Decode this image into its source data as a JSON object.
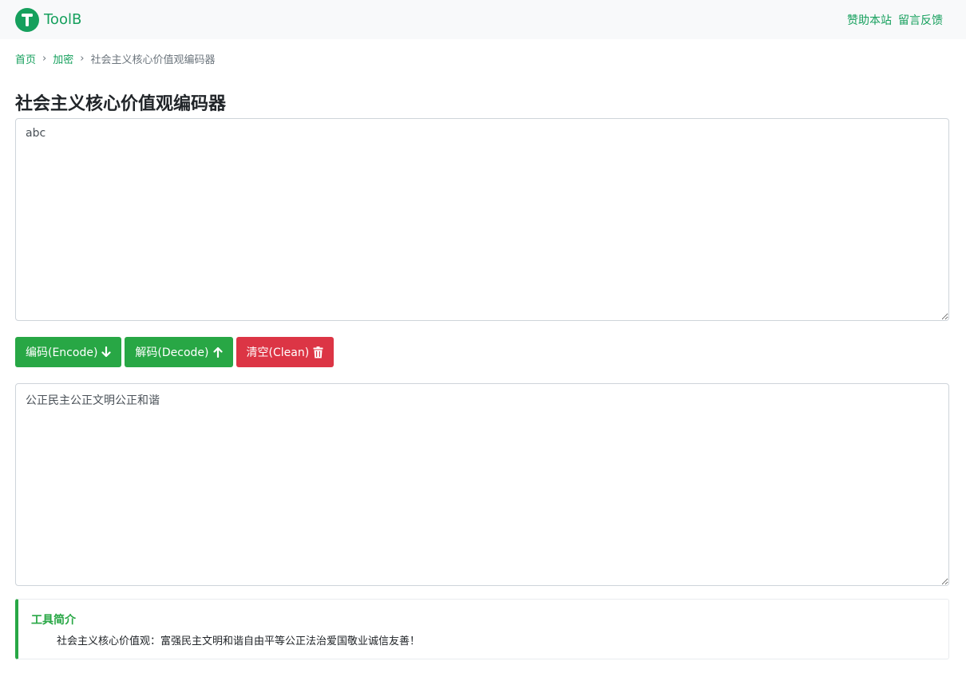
{
  "navbar": {
    "brand": "ToolB",
    "brand_icon": "tool-t-icon",
    "accent": "#16a05d",
    "links": [
      "赞助本站",
      "留言反馈"
    ]
  },
  "breadcrumb": {
    "home": "首页",
    "category": "加密",
    "current": "社会主义核心价值观编码器"
  },
  "page": {
    "title": "社会主义核心价值观编码器"
  },
  "input": {
    "value": "abc"
  },
  "buttons": {
    "encode": "编码(Encode)",
    "encode_icon": "arrow-down-icon",
    "decode": "解码(Decode)",
    "decode_icon": "arrow-up-icon",
    "clean": "清空(Clean)",
    "clean_icon": "trash-icon",
    "green": "#28a745",
    "red": "#dc3545"
  },
  "output": {
    "value": "公正民主公正文明公正和谐"
  },
  "intro": {
    "title": "工具简介",
    "text": "社会主义核心价值观：富强民主文明和谐自由平等公正法治爱国敬业诚信友善！"
  }
}
